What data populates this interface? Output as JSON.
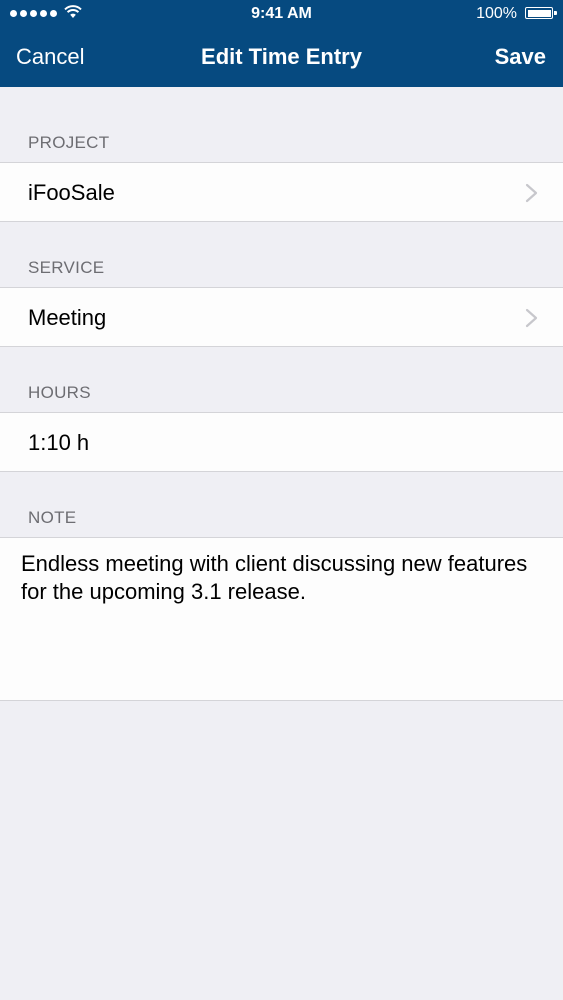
{
  "status_bar": {
    "time": "9:41 AM",
    "battery": "100%"
  },
  "nav": {
    "cancel_label": "Cancel",
    "title": "Edit Time Entry",
    "save_label": "Save"
  },
  "sections": {
    "project": {
      "header": "PROJECT",
      "value": "iFooSale"
    },
    "service": {
      "header": "SERVICE",
      "value": "Meeting"
    },
    "hours": {
      "header": "HOURS",
      "value": "1:10 h"
    },
    "note": {
      "header": "NOTE",
      "value": "Endless meeting with client discussing new features for the upcoming 3.1 release."
    }
  },
  "colors": {
    "nav_background": "#064a80",
    "page_background": "#efeff4",
    "header_text": "#6d6d72"
  },
  "icons": [
    "signal-icon",
    "wifi-icon",
    "battery-icon",
    "chevron-right-icon"
  ]
}
